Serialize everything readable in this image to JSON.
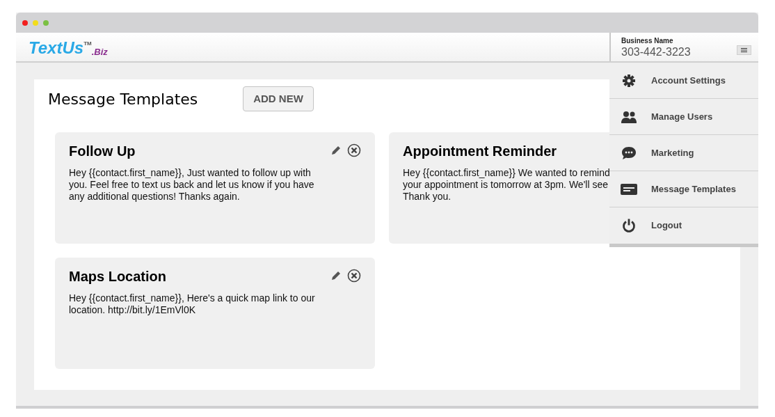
{
  "header": {
    "logo": {
      "text": "TextUs",
      "tm": "TM",
      "suffix": ".Biz"
    },
    "account": {
      "label": "Business Name",
      "phone": "303-442-3223"
    }
  },
  "page": {
    "title": "Message Templates",
    "add_button": "ADD NEW"
  },
  "templates": [
    {
      "kind": "full",
      "title": "Follow Up",
      "lines": [
        "Hey {{contact.first_name}}, Just wanted to follow up with",
        "you. Feel free to text us back and let us know if you have",
        "any additional questions! Thanks again."
      ]
    },
    {
      "kind": "covered",
      "title": "Appointment Reminder",
      "lines": [
        "Hey {{contact.first_name}} We wanted to remind",
        "your appointment is tomorrow at 3pm. We'll see",
        "Thank you."
      ]
    },
    {
      "kind": "full",
      "title": "Maps Location",
      "lines": [
        "Hey {{contact.first_name}}, Here's a quick map link to our",
        "location. http://bit.ly/1EmVl0K"
      ]
    }
  ],
  "menu": [
    {
      "kind": "settings",
      "label": "Account Settings"
    },
    {
      "kind": "users",
      "label": "Manage Users"
    },
    {
      "kind": "chat",
      "label": "Marketing"
    },
    {
      "kind": "templates",
      "label": "Message Templates"
    },
    {
      "kind": "power",
      "label": "Logout"
    }
  ]
}
